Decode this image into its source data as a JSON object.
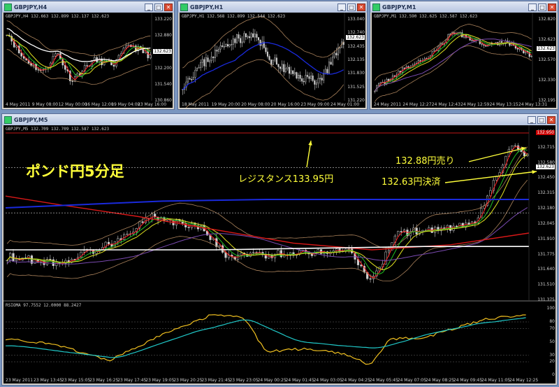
{
  "windows": {
    "h4": {
      "title": "GBPJPY,H4",
      "info": "GBPJPY,H4  132.663 132.899 132.137 132.623",
      "yticks": [
        "133.220",
        "132.880",
        "132.540",
        "132.200",
        "131.540",
        "130.860"
      ],
      "price_tag": "132.623",
      "xticks": [
        "4 May 2011",
        "9 May 08:00",
        "12 May 00:00",
        "16 May 12:00",
        "19 May 04:00",
        "23 May 16:00"
      ]
    },
    "h1": {
      "title": "GBPJPY,H1",
      "info": "GBPJPY,H1  132.568 132.899 132.544 132.623",
      "yticks": [
        "133.040",
        "132.740",
        "132.435",
        "132.135",
        "131.830",
        "131.525",
        "131.220"
      ],
      "price_tag": "132.623",
      "xticks": [
        "18 May 2011",
        "19 May 20:00",
        "20 May 08:00",
        "20 May 16:00",
        "23 May 09:00",
        "24 May 01:00"
      ]
    },
    "m1": {
      "title": "GBPJPY,M1",
      "info": "GBPJPY,M1  132.590 132.625 132.587 132.623",
      "yticks": [
        "132.820",
        "132.623",
        "132.570",
        "132.330",
        "132.195"
      ],
      "price_tag": "132.623",
      "xticks": [
        "24 May 2011",
        "24 May 12:27",
        "24 May 12:43",
        "24 May 12:59",
        "24 May 13:15",
        "24 May 13:31"
      ]
    },
    "m5": {
      "title": "GBPJPY,M5",
      "info": "GBPJPY,M5  132.709 132.709 132.587 132.623",
      "yticks": [
        "132.850",
        "132.715",
        "132.580",
        "132.450",
        "132.315",
        "132.180",
        "132.045",
        "131.910",
        "131.775",
        "131.640",
        "131.510",
        "131.375"
      ],
      "red_tag": "132.950",
      "price_tag": "132.623",
      "rsi_info": "RSIOMA  97.7552  12.0000  88.2427",
      "rsi_yticks": [
        "100",
        "80",
        "70",
        "50",
        "30",
        "20",
        "0"
      ],
      "xticks": [
        "23 May 2011",
        "23 May 13:45",
        "23 May 15:05",
        "23 May 16:25",
        "23 May 17:45",
        "23 May 19:05",
        "23 May 20:25",
        "23 May 21:45",
        "23 May 23:05",
        "24 May 00:25",
        "24 May 01:45",
        "24 May 03:05",
        "24 May 04:25",
        "24 May 05:45",
        "24 May 07:05",
        "24 May 08:25",
        "24 May 09:45",
        "24 May 11:05",
        "24 May 12:25"
      ]
    }
  },
  "annotations": {
    "heading": "ポンド円5分足",
    "resistance": "レジスタンス133.95円",
    "sell": "132.88円売り",
    "settle": "132.63円決済"
  },
  "colors": {
    "candle": "#cfcfcf",
    "ma_blue": "#1a2adc",
    "ma_red": "#d81818",
    "ma_white": "#ffffff",
    "ma_purple": "#7a4ab0",
    "band": "#a8805a",
    "rsi_yellow": "#f0c020",
    "rsi_cyan": "#20c8c8",
    "text_yellow": "#ffff3a"
  }
}
